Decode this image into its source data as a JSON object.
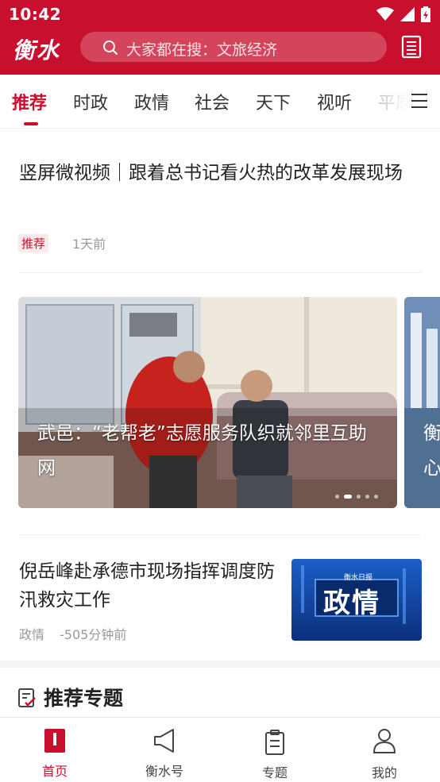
{
  "status_bar": {
    "time": "10:42"
  },
  "header": {
    "logo": "衡水",
    "search_placeholder": "大家都在搜：文旅经济",
    "icons": [
      "search-icon",
      "newspaper-icon"
    ]
  },
  "tabs": [
    {
      "label": "推荐",
      "active": true
    },
    {
      "label": "时政"
    },
    {
      "label": "政情"
    },
    {
      "label": "社会"
    },
    {
      "label": "天下"
    },
    {
      "label": "视听"
    },
    {
      "label": "平原"
    }
  ],
  "feed": {
    "article1": {
      "title": "竖屏微视频｜跟着总书记看火热的改革发展现场",
      "tag": "推荐",
      "time": "1天前"
    },
    "carousel": {
      "caption": "武邑：“老帮老”志愿服务队织就邻里互助网",
      "next_caption_partial": "衡\n心",
      "slide_count": 5,
      "active_slide": 2
    },
    "article2": {
      "title": "倪岳峰赴承德市现场指挥调度防汛救灾工作",
      "source": "政情",
      "time": "-505分钟前",
      "thumb_banner": "衡水日报",
      "thumb_text": "政情"
    }
  },
  "section": {
    "title": "推荐专题"
  },
  "bottom_nav": [
    {
      "label": "首页",
      "icon": "home-icon",
      "active": true
    },
    {
      "label": "衡水号",
      "icon": "megaphone-icon"
    },
    {
      "label": "专题",
      "icon": "clipboard-icon"
    },
    {
      "label": "我的",
      "icon": "user-icon"
    }
  ],
  "colors": {
    "brand_red": "#c8102e",
    "text": "#222222",
    "muted": "#999999"
  }
}
